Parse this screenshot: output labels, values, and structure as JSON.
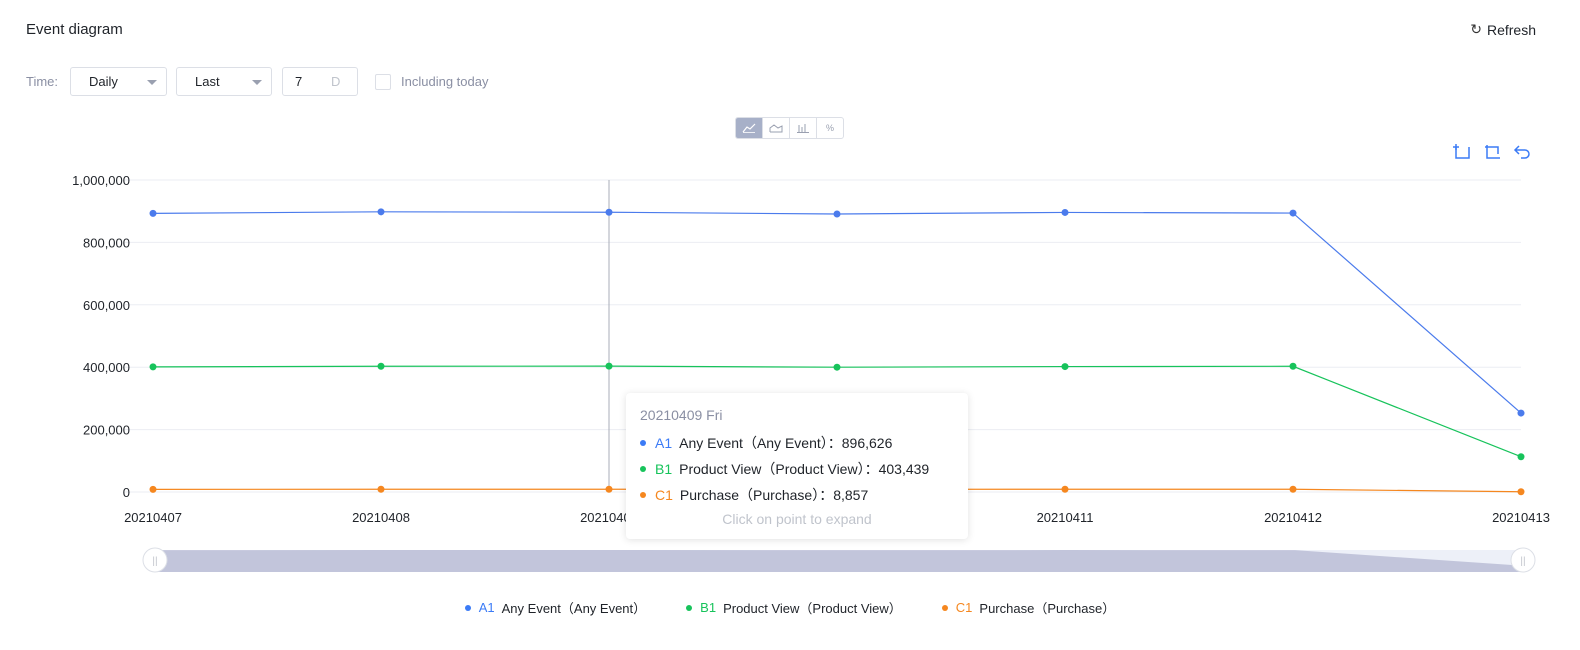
{
  "header": {
    "title": "Event diagram",
    "refresh_label": "Refresh"
  },
  "filters": {
    "time_label": "Time:",
    "granularity": "Daily",
    "range_mode": "Last",
    "range_value": "7",
    "range_unit": "D",
    "including_today_label": "Including today",
    "including_today": false
  },
  "chart_types": [
    {
      "name": "line-chart",
      "label": "",
      "active": true
    },
    {
      "name": "area-chart",
      "label": "",
      "active": false
    },
    {
      "name": "bar-chart",
      "label": "",
      "active": false
    },
    {
      "name": "percent",
      "label": "%",
      "active": false
    }
  ],
  "tooltip": {
    "date": "20210409 Fri",
    "hint": "Click on point to expand",
    "rows": [
      {
        "code": "A1",
        "label": "Any Event（Any Event）：896,626"
      },
      {
        "code": "B1",
        "label": "Product View（Product View）：403,439"
      },
      {
        "code": "C1",
        "label": "Purchase（Purchase）：8,857"
      }
    ]
  },
  "chart_data": {
    "type": "line",
    "x": [
      "20210407",
      "20210408",
      "20210409",
      "20210410",
      "20210411",
      "20210412",
      "20210413"
    ],
    "series": [
      {
        "code": "A1",
        "name": "Any Event（Any Event）",
        "color": "#4b7bec",
        "values": [
          893000,
          898000,
          896626,
          891000,
          896000,
          894000,
          253000
        ]
      },
      {
        "code": "B1",
        "name": "Product View（Product View）",
        "color": "#17c35b",
        "values": [
          401000,
          403000,
          403439,
          400000,
          402000,
          403000,
          113000
        ]
      },
      {
        "code": "C1",
        "name": "Purchase（Purchase）",
        "color": "#f5871f",
        "values": [
          8500,
          8700,
          8857,
          8600,
          8800,
          8700,
          800
        ]
      }
    ],
    "y_ticks": [
      "0",
      "200,000",
      "400,000",
      "600,000",
      "800,000",
      "1,000,000"
    ],
    "ylim": [
      0,
      1000000
    ],
    "highlight_index": 2,
    "grid": true,
    "legend": "bottom"
  }
}
